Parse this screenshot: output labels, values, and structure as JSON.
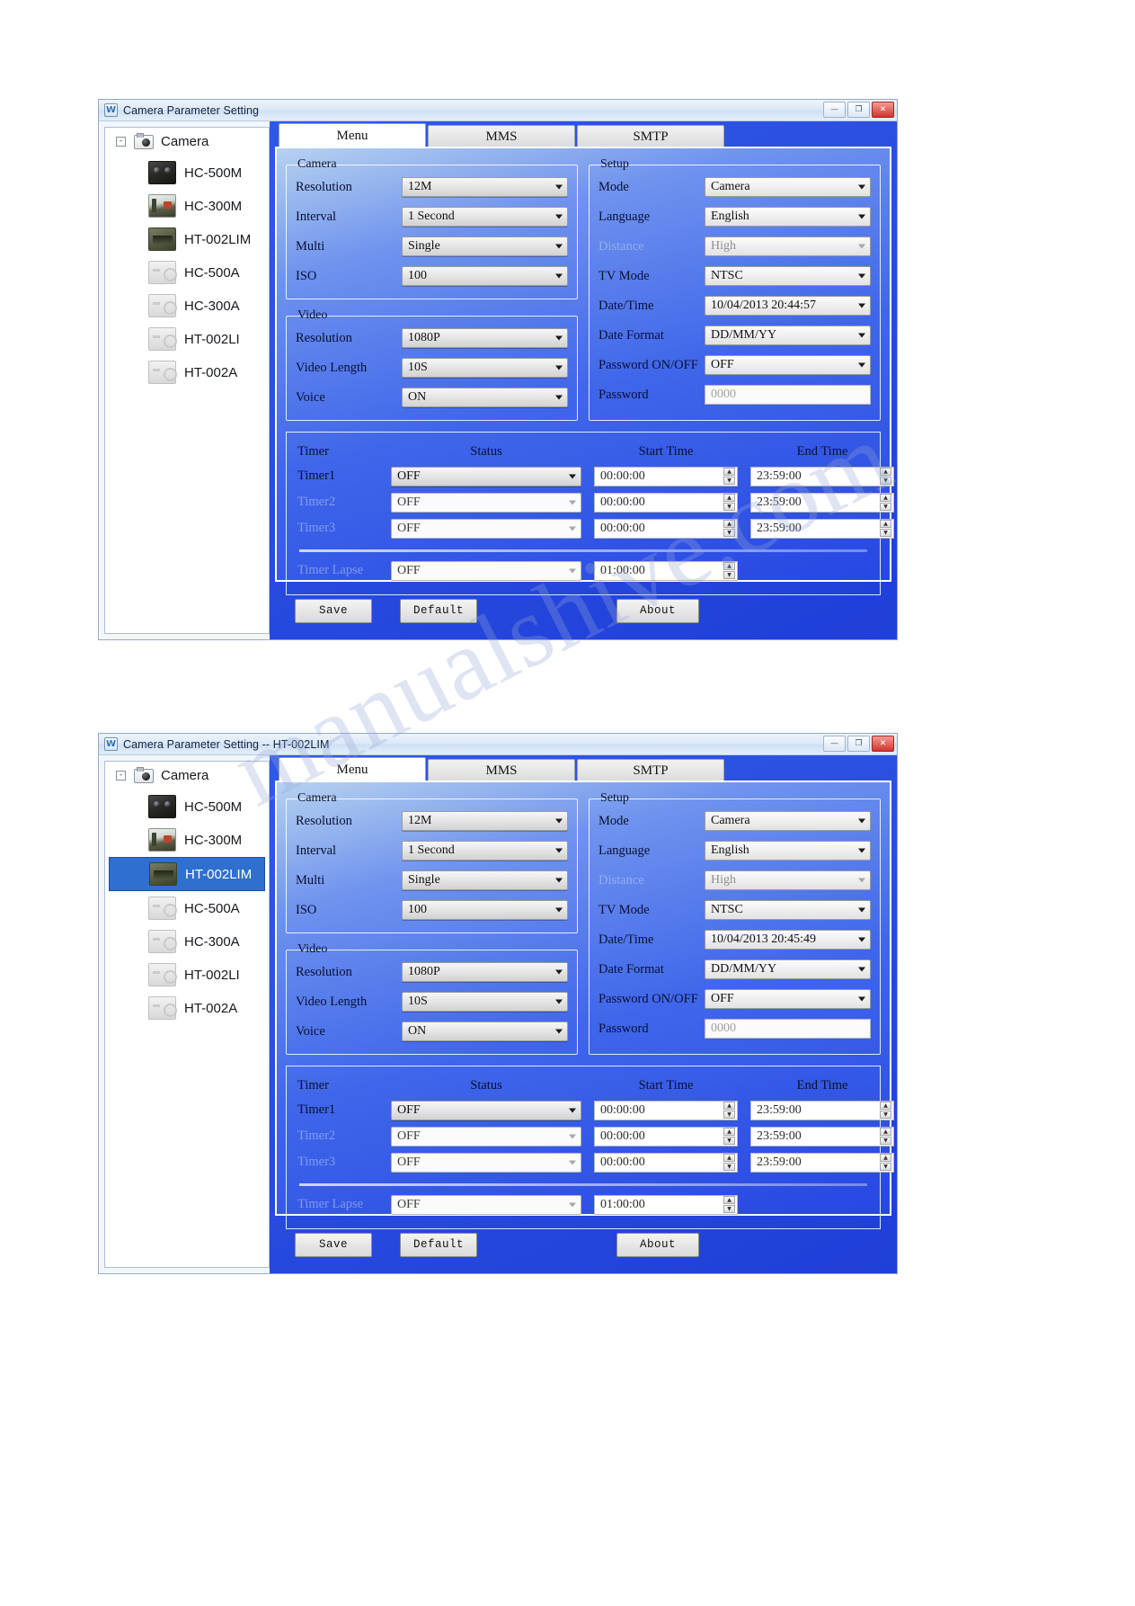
{
  "windows": [
    {
      "title": "Camera Parameter Setting",
      "icon": "app-icon",
      "selected_device": null,
      "date_time": "10/04/2013 20:44:57"
    },
    {
      "title": "Camera Parameter Setting -- HT-002LIM",
      "icon": "app-icon",
      "selected_device": "HT-002LIM",
      "date_time": "10/04/2013 20:45:49"
    }
  ],
  "window_buttons": {
    "minimize": "—",
    "maximize": "❐",
    "close": "✕"
  },
  "sidebar": {
    "root_label": "Camera",
    "expander": "-",
    "items": [
      {
        "label": "HC-500M",
        "thumb": "hc500m"
      },
      {
        "label": "HC-300M",
        "thumb": "hc300m"
      },
      {
        "label": "HT-002LIM",
        "thumb": "ht002lim"
      },
      {
        "label": "HC-500A",
        "thumb": "grey"
      },
      {
        "label": "HC-300A",
        "thumb": "grey"
      },
      {
        "label": "HT-002LI",
        "thumb": "grey"
      },
      {
        "label": "HT-002A",
        "thumb": "grey"
      }
    ]
  },
  "tabs": [
    {
      "label": "Menu",
      "active": true
    },
    {
      "label": "MMS",
      "active": false
    },
    {
      "label": "SMTP",
      "active": false
    }
  ],
  "camera_group": {
    "legend": "Camera",
    "rows": [
      {
        "label": "Resolution",
        "value": "12M",
        "dim": false
      },
      {
        "label": "Interval",
        "value": "1  Second",
        "dim": false
      },
      {
        "label": "Multi",
        "value": "Single",
        "dim": false
      },
      {
        "label": "ISO",
        "value": "100",
        "dim": false
      }
    ]
  },
  "video_group": {
    "legend": "Video",
    "rows": [
      {
        "label": "Resolution",
        "value": "1080P",
        "dim": false
      },
      {
        "label": "Video Length",
        "value": "10S",
        "dim": false
      },
      {
        "label": "Voice",
        "value": "ON",
        "dim": false
      }
    ]
  },
  "setup_group": {
    "legend": "Setup",
    "rows": [
      {
        "label": "Mode",
        "value": "Camera",
        "dim": false,
        "type": "combo"
      },
      {
        "label": "Language",
        "value": "English",
        "dim": false,
        "type": "combo"
      },
      {
        "label": "Distance",
        "value": "High",
        "dim": true,
        "type": "combo"
      },
      {
        "label": "TV Mode",
        "value": "NTSC",
        "dim": false,
        "type": "combo"
      },
      {
        "label": "Date/Time",
        "value": "10/04/2013 20:44:57",
        "dim": false,
        "type": "combo"
      },
      {
        "label": "Date Format",
        "value": "DD/MM/YY",
        "dim": false,
        "type": "combo"
      },
      {
        "label": "Password ON/OFF",
        "value": "OFF",
        "dim": false,
        "type": "combo"
      },
      {
        "label": "Password",
        "value": "0000",
        "dim": true,
        "type": "text"
      }
    ]
  },
  "timer_section": {
    "headers": {
      "timer": "Timer",
      "status": "Status",
      "start": "Start Time",
      "end": "End Time"
    },
    "rows": [
      {
        "label": "Timer1",
        "status": "OFF",
        "start": "00:00:00",
        "end": "23:59:00",
        "dim": false
      },
      {
        "label": "Timer2",
        "status": "OFF",
        "start": "00:00:00",
        "end": "23:59:00",
        "dim": true
      },
      {
        "label": "Timer3",
        "status": "OFF",
        "start": "00:00:00",
        "end": "23:59:00",
        "dim": true
      }
    ],
    "lapse": {
      "label": "Timer Lapse",
      "status": "OFF",
      "start": "01:00:00",
      "dim": true
    }
  },
  "buttons": {
    "save": "Save",
    "default": "Default",
    "about": "About"
  },
  "spinner": {
    "up": "▲",
    "down": "▼"
  },
  "watermark": "manualshive.com",
  "colors": {
    "panel_blue": "#2747e2",
    "selection_blue": "#2f6fd0",
    "close_red": "#d0342c"
  }
}
